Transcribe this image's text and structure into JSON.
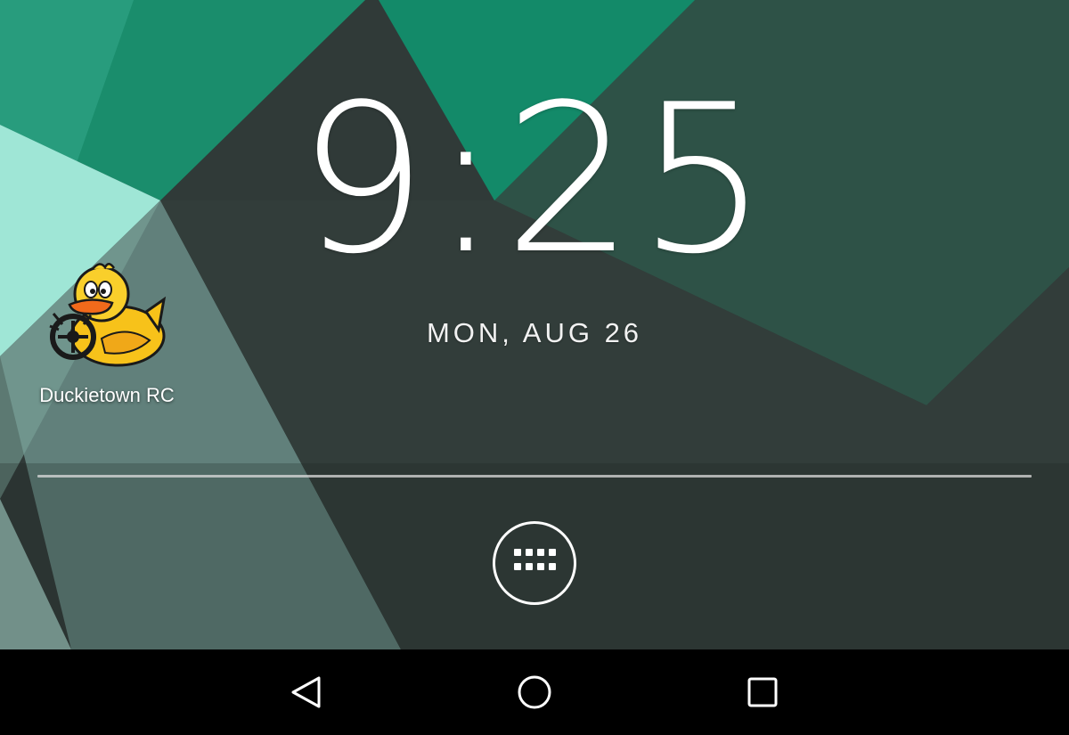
{
  "lockscreen": {
    "time": "9:25",
    "date": "MON, AUG 26"
  },
  "home": {
    "shortcuts": [
      {
        "label": "Duckietown RC",
        "icon": "duck-icon"
      }
    ],
    "app_drawer_icon": "app-grid-icon"
  },
  "navbar": {
    "buttons": [
      {
        "name": "back",
        "icon": "back-triangle-icon"
      },
      {
        "name": "home",
        "icon": "home-circle-icon"
      },
      {
        "name": "recents",
        "icon": "recents-square-icon"
      }
    ]
  },
  "colors": {
    "teal_bright": "#0e8a67",
    "teal_light": "#7fd9c6",
    "mint": "#a9ece0",
    "dark_slate": "#2f3a37",
    "navbar": "#000000"
  }
}
